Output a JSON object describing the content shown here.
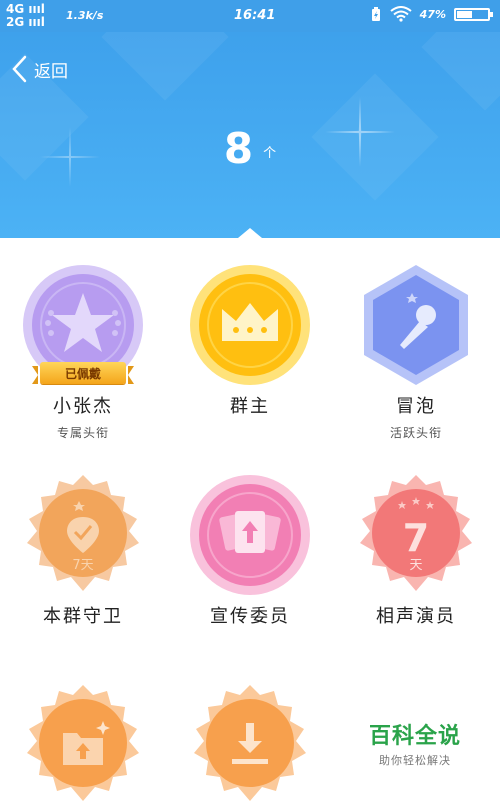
{
  "status_bar": {
    "network_1": "4G",
    "network_2": "2G",
    "speed": "1.3k/s",
    "time": "16:41",
    "battery_percent": "47%",
    "battery_level": 0.47
  },
  "header": {
    "back_label": "返回",
    "count": "8",
    "count_unit": "个"
  },
  "badges": [
    {
      "name": "小张杰",
      "sub": "专属头衔",
      "worn_label": "已佩戴"
    },
    {
      "name": "群主",
      "sub": ""
    },
    {
      "name": "冒泡",
      "sub": "活跃头衔"
    },
    {
      "name": "本群守卫",
      "sub": "",
      "days_label": "7天"
    },
    {
      "name": "宣传委员",
      "sub": ""
    },
    {
      "name": "相声演员",
      "sub": "",
      "days_number": "7",
      "days_unit": "天"
    },
    {
      "name": "",
      "sub": ""
    },
    {
      "name": "",
      "sub": ""
    }
  ],
  "watermark": {
    "title": "百科全说",
    "subtitle": "助你轻松解决"
  },
  "colors": {
    "header_blue": "#3ea1ec",
    "purple": "#b79cf0",
    "gold": "#ffbf10",
    "indigo": "#7b93f0",
    "orange": "#f2a55b",
    "pink": "#f27fb4",
    "salmon": "#f27878"
  }
}
